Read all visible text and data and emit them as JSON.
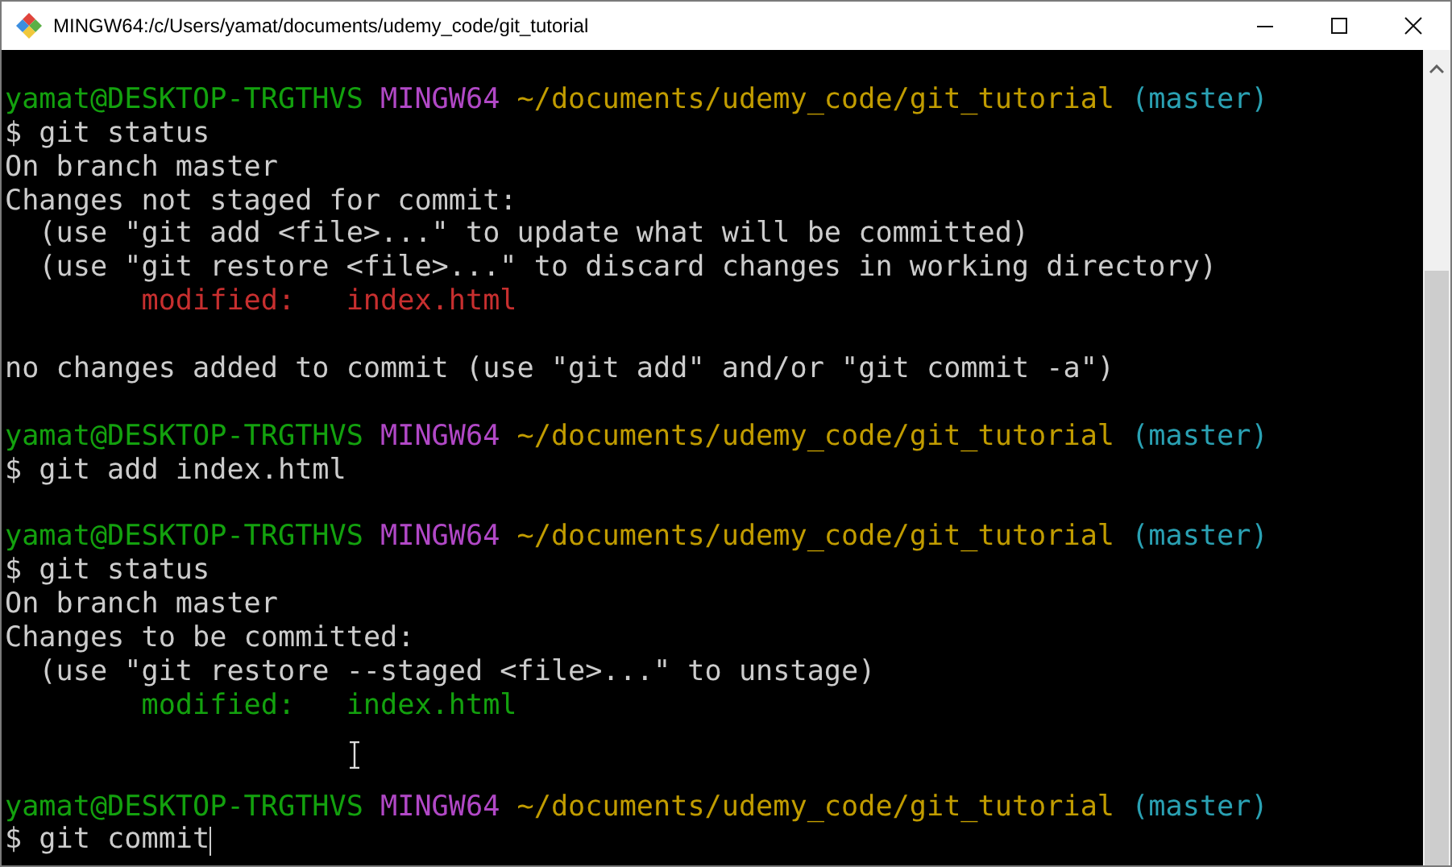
{
  "window": {
    "title": "MINGW64:/c/Users/yamat/documents/udemy_code/git_tutorial"
  },
  "lines": [
    {
      "kind": "blank"
    },
    {
      "kind": "prompt",
      "user": "yamat@DESKTOP-TRGTHVS",
      "shell": "MINGW64",
      "path": "~/documents/udemy_code/git_tutorial",
      "branch": "(master)"
    },
    {
      "kind": "command",
      "text": "$ git status",
      "cursor": false
    },
    {
      "kind": "output",
      "text": "On branch master"
    },
    {
      "kind": "output",
      "text": "Changes not staged for commit:"
    },
    {
      "kind": "hint",
      "text": "(use \"git add <file>...\" to update what will be committed)"
    },
    {
      "kind": "hint",
      "text": "(use \"git restore <file>...\" to discard changes in working directory)"
    },
    {
      "kind": "file",
      "label": "modified:",
      "file": "index.html",
      "staged": false
    },
    {
      "kind": "blank"
    },
    {
      "kind": "output",
      "text": "no changes added to commit (use \"git add\" and/or \"git commit -a\")"
    },
    {
      "kind": "blank"
    },
    {
      "kind": "prompt",
      "user": "yamat@DESKTOP-TRGTHVS",
      "shell": "MINGW64",
      "path": "~/documents/udemy_code/git_tutorial",
      "branch": "(master)"
    },
    {
      "kind": "command",
      "text": "$ git add index.html",
      "cursor": false
    },
    {
      "kind": "blank"
    },
    {
      "kind": "prompt",
      "user": "yamat@DESKTOP-TRGTHVS",
      "shell": "MINGW64",
      "path": "~/documents/udemy_code/git_tutorial",
      "branch": "(master)"
    },
    {
      "kind": "command",
      "text": "$ git status",
      "cursor": false
    },
    {
      "kind": "output",
      "text": "On branch master"
    },
    {
      "kind": "output",
      "text": "Changes to be committed:"
    },
    {
      "kind": "hint",
      "text": "(use \"git restore --staged <file>...\" to unstage)"
    },
    {
      "kind": "file",
      "label": "modified:",
      "file": "index.html",
      "staged": true
    },
    {
      "kind": "blank"
    },
    {
      "kind": "blank"
    },
    {
      "kind": "prompt",
      "user": "yamat@DESKTOP-TRGTHVS",
      "shell": "MINGW64",
      "path": "~/documents/udemy_code/git_tutorial",
      "branch": "(master)"
    },
    {
      "kind": "command",
      "text": "$ git commit",
      "cursor": true
    }
  ]
}
